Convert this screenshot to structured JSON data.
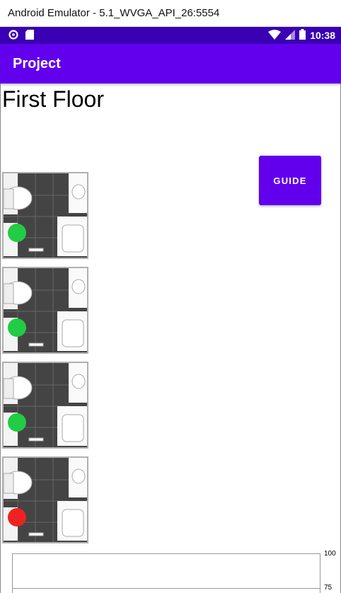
{
  "window": {
    "title": "Android Emulator - 5.1_WVGA_API_26:5554"
  },
  "status_bar": {
    "time": "10:38",
    "left_icons": [
      "circle-notification-icon",
      "sd-card-icon"
    ],
    "right_icons": [
      "wifi-icon",
      "signal-icon",
      "battery-icon"
    ]
  },
  "app_bar": {
    "title": "Project",
    "color": "#6200ee"
  },
  "page": {
    "title": "First Floor"
  },
  "guide_button": {
    "label": "GUIDE"
  },
  "stalls": [
    {
      "status": "available",
      "color": "#22cc44"
    },
    {
      "status": "available",
      "color": "#22cc44"
    },
    {
      "status": "available",
      "color": "#22cc44"
    },
    {
      "status": "occupied",
      "color": "#ee2222"
    }
  ],
  "chart": {
    "ticks": [
      "100",
      "75"
    ]
  }
}
